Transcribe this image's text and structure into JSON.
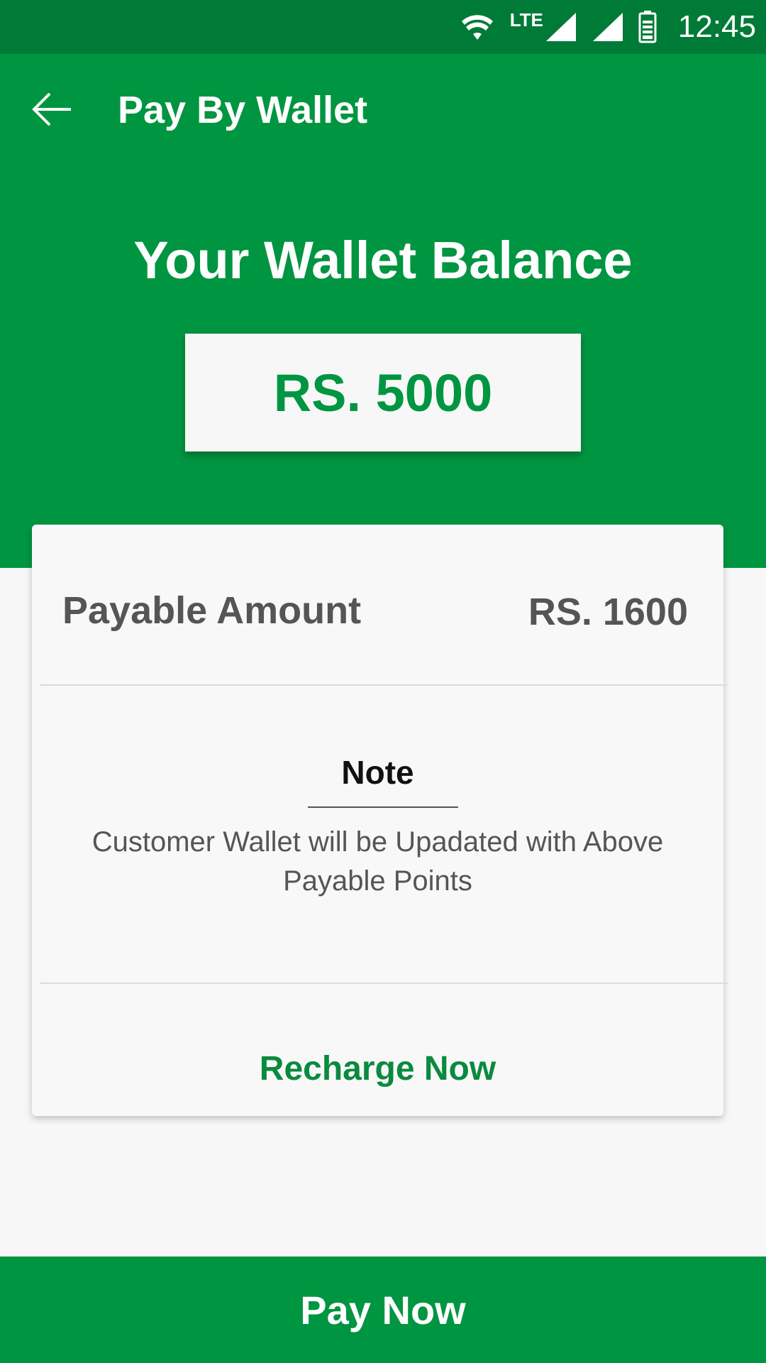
{
  "status_bar": {
    "network_label": "LTE",
    "time": "12:45"
  },
  "app_bar": {
    "title": "Pay By Wallet",
    "back_icon": "arrow-back-icon"
  },
  "wallet": {
    "heading": "Your Wallet Balance",
    "balance": "RS. 5000"
  },
  "payment_card": {
    "payable_label": "Payable Amount",
    "payable_value": "RS. 1600",
    "note_title": "Note",
    "note_text": "Customer Wallet will be Upadated with Above Payable Points",
    "recharge_label": "Recharge Now"
  },
  "footer": {
    "pay_label": "Pay Now"
  },
  "colors": {
    "primary": "#009541",
    "status_bar": "#007a37",
    "background": "#f7f7f7",
    "text_gray": "#555555"
  }
}
